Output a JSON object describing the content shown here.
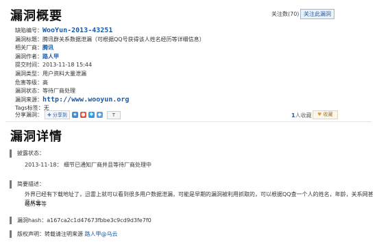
{
  "header": {
    "title": "漏洞概要",
    "follow_count_label": "关注数(70)",
    "follow_button": "关注此漏洞"
  },
  "summary": {
    "bug_id_label": "缺陷编号：",
    "bug_id": "WooYun-2013-43251",
    "title_label": "漏洞标题：",
    "title": "腾讯群关系数据泄漏（可根据QQ号获得该人姓名经历等详细信息）",
    "vendor_label": "相关厂商：",
    "vendor": "腾讯",
    "author_label": "漏洞作者：",
    "author": "路人甲",
    "submit_label": "提交时间：",
    "submit_time": "2013-11-18 15:44",
    "type_label": "漏洞类型：",
    "type": "用户资料大量泄漏",
    "level_label": "危害等级：",
    "level": "高",
    "status_label": "漏洞状态：",
    "status": "等待厂商处理",
    "source_label": "漏洞来源：",
    "source": "http://www.wooyun.org",
    "tags_label": "Tags标签：",
    "tags": "无"
  },
  "share": {
    "label": "分享漏洞：",
    "share_btn": "分享到",
    "t_btn": "T",
    "collect_count": "1",
    "collect_label": "人收藏",
    "fav_btn": "收藏"
  },
  "detail": {
    "title": "漏洞详情",
    "disclosure_label": "披露状态：",
    "disclosure_text": "2013-11-18：  细节已通知厂商并且等待厂商处理中",
    "brief_label": "简要描述：",
    "brief_text_1": "外界已经有下载地址了，迅雷上就可以看到很多用户数据泄漏，可能是早期的漏洞被利用抓取的，可以根据QQ查一个人的姓名，年龄，关系网甚至从业",
    "brief_text_2": "经历等等",
    "hash": "漏洞hash：a167ca2c1d47673fbbe3c9cd9d3fe7f0",
    "copyright_label": "版权声明：转载请注明来源 ",
    "copyright_link": "路人甲@乌云"
  }
}
